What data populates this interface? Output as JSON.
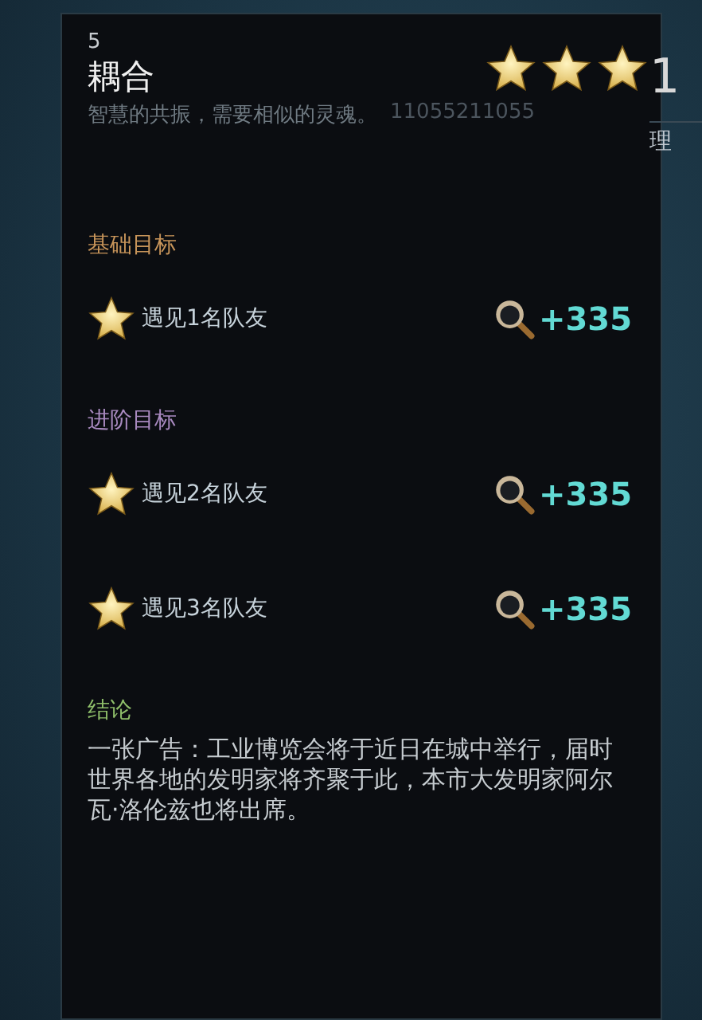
{
  "header": {
    "number": "5",
    "title": "耦合",
    "subtitle": "智慧的共振，需要相似的灵魂。",
    "faint_code": "11055211055",
    "stars": 3,
    "side_value": "1",
    "side_label": "理"
  },
  "sections": [
    {
      "title": "基础目标",
      "kind": "basic",
      "goals": [
        {
          "text": "遇见1名队友",
          "reward": "+335"
        }
      ]
    },
    {
      "title": "进阶目标",
      "kind": "advanced",
      "goals": [
        {
          "text": "遇见2名队友",
          "reward": "+335"
        },
        {
          "text": "遇见3名队友",
          "reward": "+335"
        }
      ]
    }
  ],
  "conclusion": {
    "title": "结论",
    "text": "一张广告：工业博览会将于近日在城中举行，届时世界各地的发明家将齐聚于此，本市大发明家阿尔瓦·洛伦兹也将出席。"
  }
}
